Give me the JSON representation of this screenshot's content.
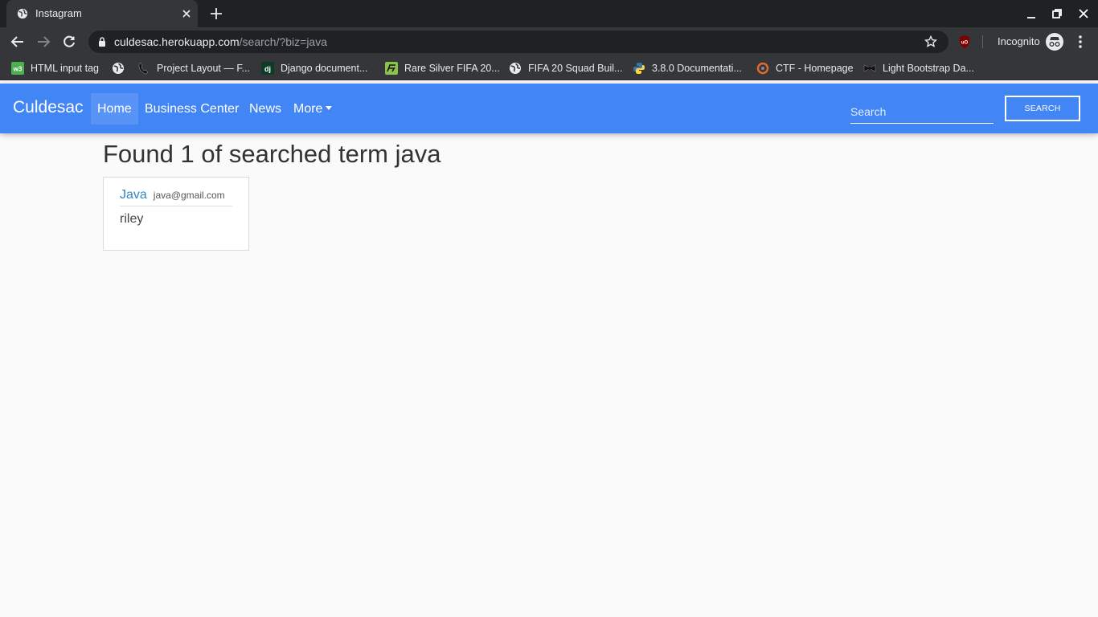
{
  "browser": {
    "tab_title": "Instagram",
    "url_host": "culdesac.herokuapp.com",
    "url_path": "/search/?biz=java",
    "incognito_label": "Incognito",
    "bookmarks": [
      {
        "label": "HTML input tag",
        "icon": "w3schools-icon"
      },
      {
        "label": "",
        "icon": "globe-icon"
      },
      {
        "label": "Project Layout — F...",
        "icon": "phone-icon"
      },
      {
        "label": "Django document...",
        "icon": "django-icon"
      },
      {
        "label": "Rare Silver FIFA 20...",
        "icon": "futbin-icon"
      },
      {
        "label": "FIFA 20 Squad Buil...",
        "icon": "globe-icon"
      },
      {
        "label": "3.8.0 Documentati...",
        "icon": "python-icon"
      },
      {
        "label": "CTF - Homepage",
        "icon": "ctf-icon"
      },
      {
        "label": "Light Bootstrap Da...",
        "icon": "bowtie-icon"
      }
    ]
  },
  "navbar": {
    "brand": "Culdesac",
    "items": [
      {
        "label": "Home",
        "active": true
      },
      {
        "label": "Business Center",
        "active": false
      },
      {
        "label": "News",
        "active": false
      },
      {
        "label": "More",
        "active": false
      }
    ],
    "search_placeholder": "Search",
    "search_button": "SEARCH",
    "color": "#4285f4"
  },
  "results": {
    "heading": "Found 1 of searched term java",
    "cards": [
      {
        "name": "Java",
        "email": "java@gmail.com",
        "body": "riley"
      }
    ]
  }
}
